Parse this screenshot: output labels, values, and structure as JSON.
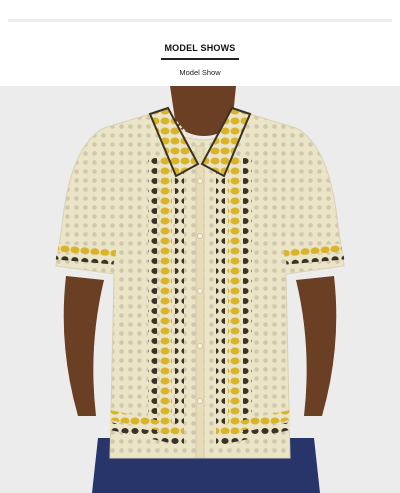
{
  "section": {
    "title": "MODEL SHOWS",
    "subtitle": "Model Show"
  },
  "photo": {
    "alt_label": "model-photo",
    "colors": {
      "background": "#ececec",
      "shirt": "#ece4c6",
      "yellow": "#d8b42a",
      "dark": "#3a3226",
      "jeans": "#27356b",
      "skin": "#6b3f24"
    }
  }
}
